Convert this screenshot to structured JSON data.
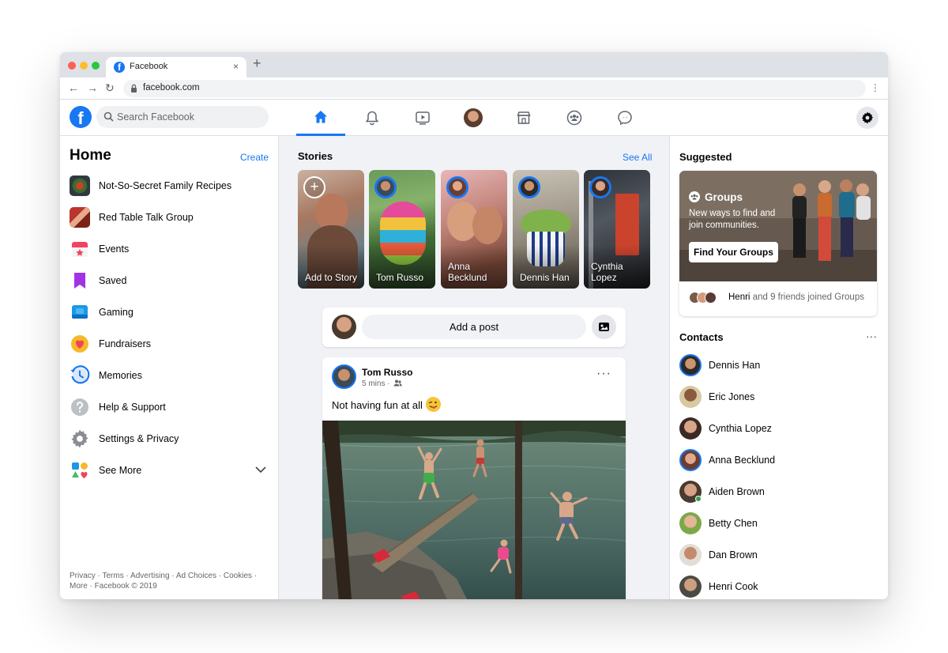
{
  "browser": {
    "tab_title": "Facebook",
    "url": "facebook.com",
    "close_glyph": "×",
    "newtab_glyph": "+",
    "back_glyph": "←",
    "forward_glyph": "→",
    "reload_glyph": "↻",
    "menu_glyph": "⋮"
  },
  "header": {
    "logo_letter": "f",
    "search_placeholder": "Search Facebook",
    "nav_icons": [
      "home-icon",
      "notifications-icon",
      "watch-icon",
      "profile-avatar",
      "marketplace-icon",
      "groups-icon",
      "messenger-icon"
    ],
    "settings_icon": "gear-icon",
    "accent_color": "#1877f2"
  },
  "sidebar": {
    "title": "Home",
    "create_label": "Create",
    "items": [
      {
        "label": "Not-So-Secret Family Recipes",
        "icon": "group-photo"
      },
      {
        "label": "Red Table Talk Group",
        "icon": "group-photo"
      },
      {
        "label": "Events",
        "icon": "calendar-icon"
      },
      {
        "label": "Saved",
        "icon": "bookmark-icon"
      },
      {
        "label": "Gaming",
        "icon": "gaming-icon"
      },
      {
        "label": "Fundraisers",
        "icon": "heart-icon"
      },
      {
        "label": "Memories",
        "icon": "clock-icon"
      },
      {
        "label": "Help & Support",
        "icon": "question-icon"
      },
      {
        "label": "Settings & Privacy",
        "icon": "gear-icon"
      },
      {
        "label": "See More",
        "icon": "apps-icon"
      }
    ],
    "footer_line1": "Privacy · Terms · Advertising · Ad Choices · Cookies ·",
    "footer_line2": "More · Facebook © 2019"
  },
  "stories": {
    "title": "Stories",
    "see_all": "See All",
    "add_glyph": "+",
    "items": [
      {
        "name": "Add to Story"
      },
      {
        "name": "Tom Russo"
      },
      {
        "name": "Anna Becklund"
      },
      {
        "name": "Dennis Han"
      },
      {
        "name": "Cynthia Lopez"
      }
    ]
  },
  "composer": {
    "label": "Add a post"
  },
  "post": {
    "author": "Tom Russo",
    "time": "5 mins ·",
    "text": "Not having fun at all",
    "more_glyph": "···"
  },
  "suggested": {
    "title": "Suggested",
    "card_title": "Groups",
    "card_subtitle": "New ways to find and join communities.",
    "button_label": "Find Your Groups",
    "footer_name": "Henri",
    "footer_rest": "and 9 friends joined Groups"
  },
  "contacts": {
    "title": "Contacts",
    "more_glyph": "···",
    "items": [
      {
        "name": "Dennis Han"
      },
      {
        "name": "Eric Jones"
      },
      {
        "name": "Cynthia Lopez"
      },
      {
        "name": "Anna Becklund"
      },
      {
        "name": "Aiden Brown"
      },
      {
        "name": "Betty Chen"
      },
      {
        "name": "Dan Brown"
      },
      {
        "name": "Henri Cook"
      }
    ]
  }
}
